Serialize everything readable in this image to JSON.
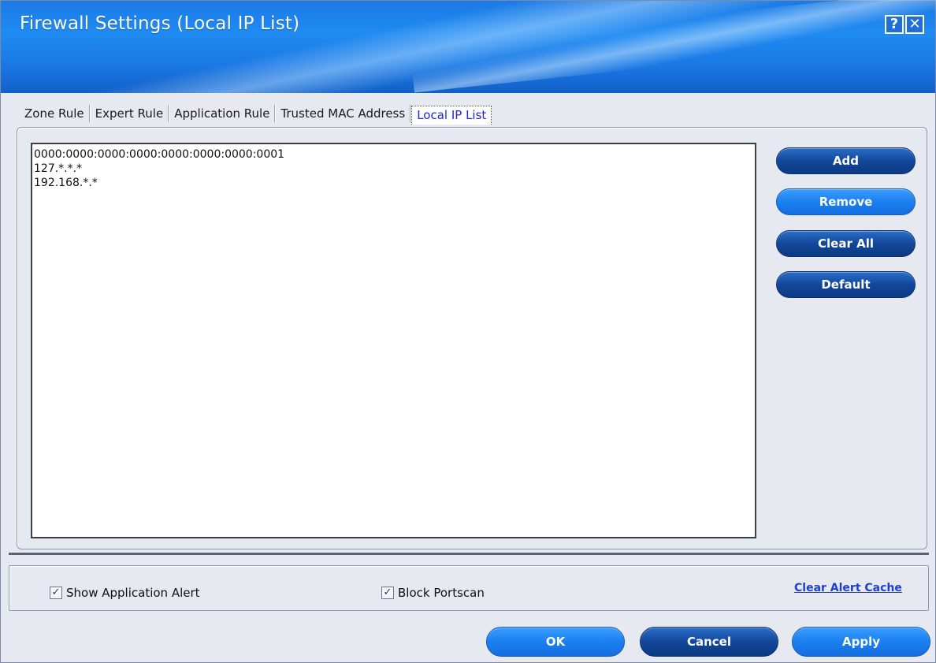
{
  "window": {
    "title": "Firewall Settings (Local IP List)",
    "help_glyph": "?",
    "close_glyph": "✕"
  },
  "tabs": [
    {
      "label": "Zone Rule",
      "active": false
    },
    {
      "label": "Expert Rule",
      "active": false
    },
    {
      "label": "Application Rule",
      "active": false
    },
    {
      "label": "Trusted MAC Address",
      "active": false
    },
    {
      "label": "Local IP List",
      "active": true
    }
  ],
  "ip_list": {
    "entries": [
      "0000:0000:0000:0000:0000:0000:0000:0001",
      "127.*.*.*",
      "192.168.*.*"
    ]
  },
  "side_buttons": {
    "add": "Add",
    "remove": "Remove",
    "clear_all": "Clear All",
    "default": "Default"
  },
  "options": {
    "show_app_alert": {
      "label": "Show Application Alert",
      "checked": true
    },
    "block_portscan": {
      "label": "Block Portscan",
      "checked": true
    },
    "clear_alert_cache": "Clear Alert Cache",
    "check_glyph": "✓"
  },
  "footer": {
    "ok": "OK",
    "cancel": "Cancel",
    "apply": "Apply"
  },
  "colors": {
    "title_blue": "#1f8bf2",
    "button_dark": "#12479a",
    "button_light": "#1a80f0",
    "active_tab_text": "#1d27d6",
    "link": "#1d3fd2"
  }
}
